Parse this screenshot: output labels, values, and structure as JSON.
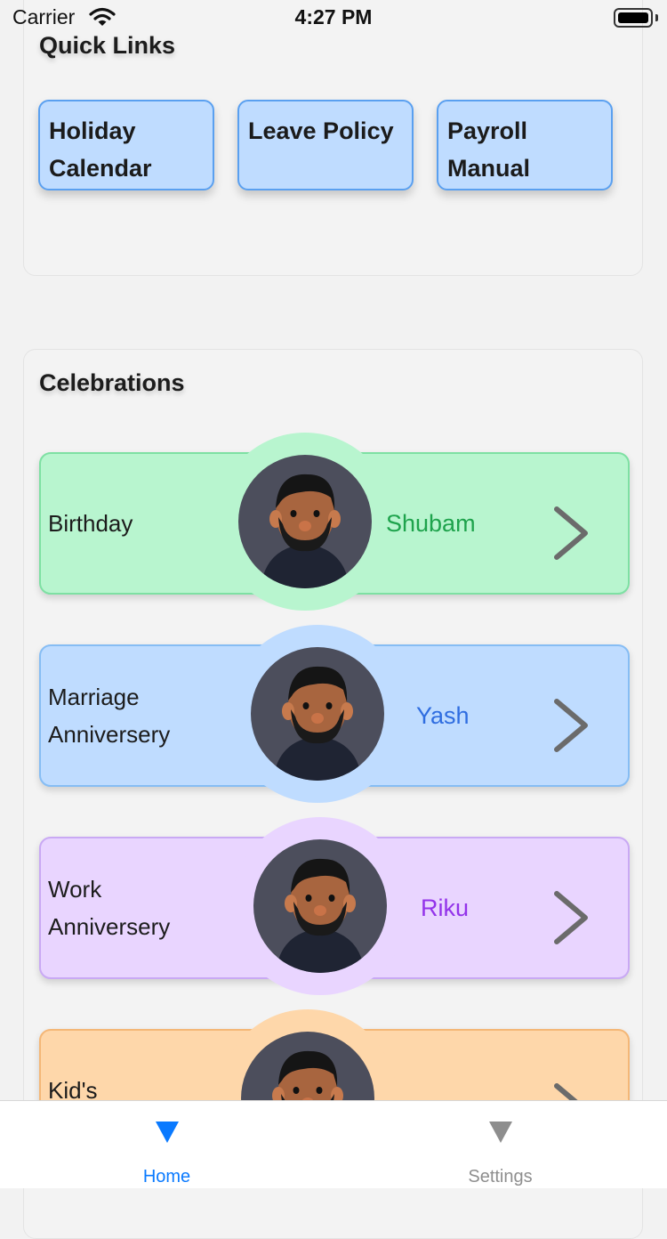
{
  "status_bar": {
    "carrier": "Carrier",
    "time": "4:27 PM"
  },
  "quick_links": {
    "title": "Quick Links",
    "items": [
      {
        "label": "Holiday Calendar"
      },
      {
        "label": "Leave Policy"
      },
      {
        "label": "Payroll Manual"
      }
    ]
  },
  "celebrations": {
    "title": "Celebrations",
    "items": [
      {
        "type": "Birthday",
        "name": "Shubam",
        "bg": "#b8f5cf",
        "border": "#7ee0a3",
        "halo": "#b8f5cf",
        "name_color": "#1ea34c"
      },
      {
        "type": "Marriage Anniversery",
        "name": "Yash",
        "bg": "#bfdcff",
        "border": "#86bdf4",
        "halo": "#bfdcff",
        "name_color": "#2f6de0"
      },
      {
        "type": "Work Anniversery",
        "name": "Riku",
        "bg": "#e9d5ff",
        "border": "#c9a9f4",
        "halo": "#e9d5ff",
        "name_color": "#9333ea"
      },
      {
        "type": "Kid's",
        "name": "",
        "bg": "#fed7aa",
        "border": "#f4b777",
        "halo": "#fed7aa",
        "name_color": "#c2410c"
      }
    ]
  },
  "tab_bar": {
    "items": [
      {
        "label": "Home",
        "icon": "triangle-down-icon",
        "color": "#0a7aff",
        "active": true
      },
      {
        "label": "Settings",
        "icon": "triangle-down-icon",
        "color": "#8e8e8e",
        "active": false
      }
    ]
  }
}
